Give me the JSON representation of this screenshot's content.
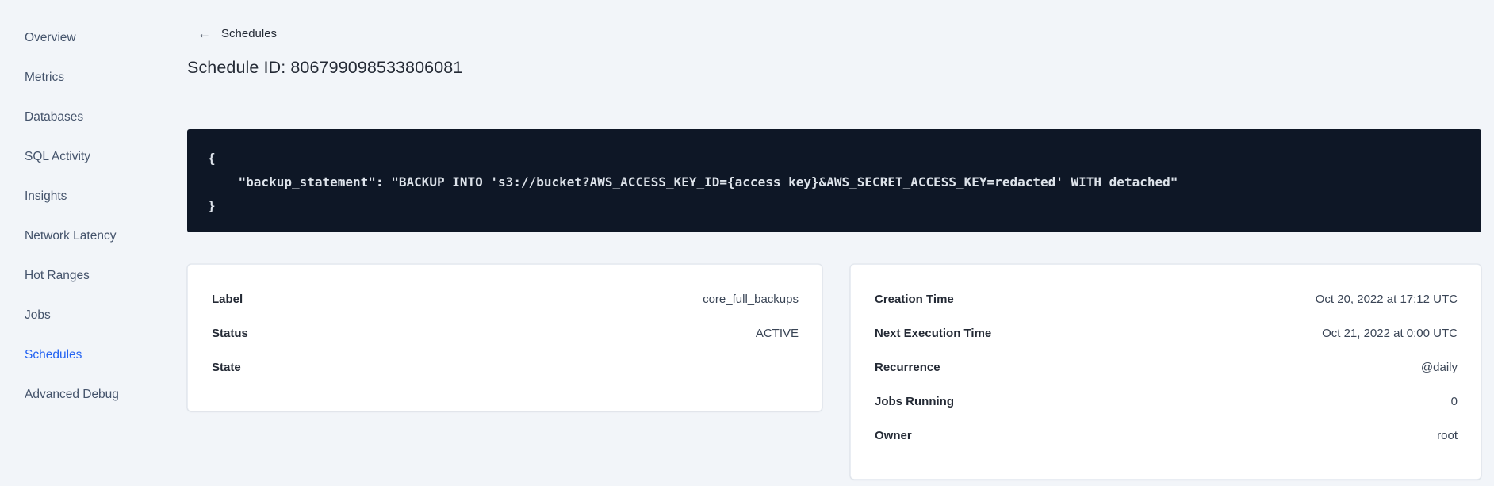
{
  "sidebar": {
    "items": [
      {
        "label": "Overview",
        "active": false
      },
      {
        "label": "Metrics",
        "active": false
      },
      {
        "label": "Databases",
        "active": false
      },
      {
        "label": "SQL Activity",
        "active": false
      },
      {
        "label": "Insights",
        "active": false
      },
      {
        "label": "Network Latency",
        "active": false
      },
      {
        "label": "Hot Ranges",
        "active": false
      },
      {
        "label": "Jobs",
        "active": false
      },
      {
        "label": "Schedules",
        "active": true
      },
      {
        "label": "Advanced Debug",
        "active": false
      }
    ]
  },
  "header": {
    "back_arrow": "←",
    "back_label": "Schedules",
    "title": "Schedule ID: 806799098533806081"
  },
  "code_block": {
    "text": "{\n    \"backup_statement\": \"BACKUP INTO 's3://bucket?AWS_ACCESS_KEY_ID={access key}&AWS_SECRET_ACCESS_KEY=redacted' WITH detached\"\n}"
  },
  "cards": {
    "schedule_details": {
      "rows": [
        {
          "label": "Label",
          "value": "core_full_backups"
        },
        {
          "label": "Status",
          "value": "ACTIVE"
        },
        {
          "label": "State",
          "value": ""
        }
      ]
    },
    "execution_details": {
      "rows": [
        {
          "label": "Creation Time",
          "value": "Oct 20, 2022 at 17:12 UTC"
        },
        {
          "label": "Next Execution Time",
          "value": "Oct 21, 2022 at 0:00 UTC"
        },
        {
          "label": "Recurrence",
          "value": "@daily"
        },
        {
          "label": "Jobs Running",
          "value": "0"
        },
        {
          "label": "Owner",
          "value": "root"
        }
      ]
    }
  },
  "colors": {
    "page_bg": "#f2f5f9",
    "accent_link": "#2463f2",
    "code_bg": "#0e1726",
    "code_text": "#dde3ea",
    "heading_text": "#242a35",
    "body_text": "#394455"
  }
}
